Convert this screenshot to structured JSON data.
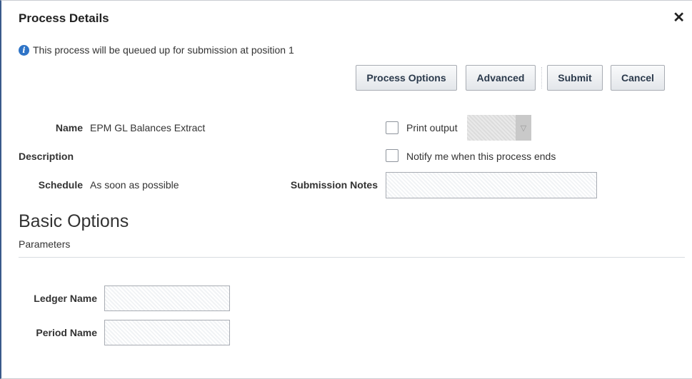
{
  "dialog": {
    "title": "Process Details",
    "close_icon": "close-icon",
    "info_icon": "info-icon",
    "info_message": "This process will be queued up for submission at position 1"
  },
  "buttons": {
    "process_options": "Process Options",
    "advanced": "Advanced",
    "submit": "Submit",
    "cancel": "Cancel"
  },
  "fields": {
    "name_label": "Name",
    "name_value": "EPM GL Balances Extract",
    "description_label": "Description",
    "description_value": "",
    "schedule_label": "Schedule",
    "schedule_value": "As soon as possible",
    "print_output_label": "Print output",
    "print_output_checked": false,
    "notify_label": "Notify me when this process ends",
    "notify_checked": false,
    "submission_notes_label": "Submission Notes",
    "submission_notes_value": ""
  },
  "basic_options": {
    "title": "Basic Options",
    "subtitle": "Parameters",
    "ledger_name_label": "Ledger Name",
    "ledger_name_value": "",
    "period_name_label": "Period Name",
    "period_name_value": ""
  },
  "colors": {
    "info_blue": "#2f74c7",
    "button_text": "#2b3a4c",
    "border": "#a8acb3"
  }
}
